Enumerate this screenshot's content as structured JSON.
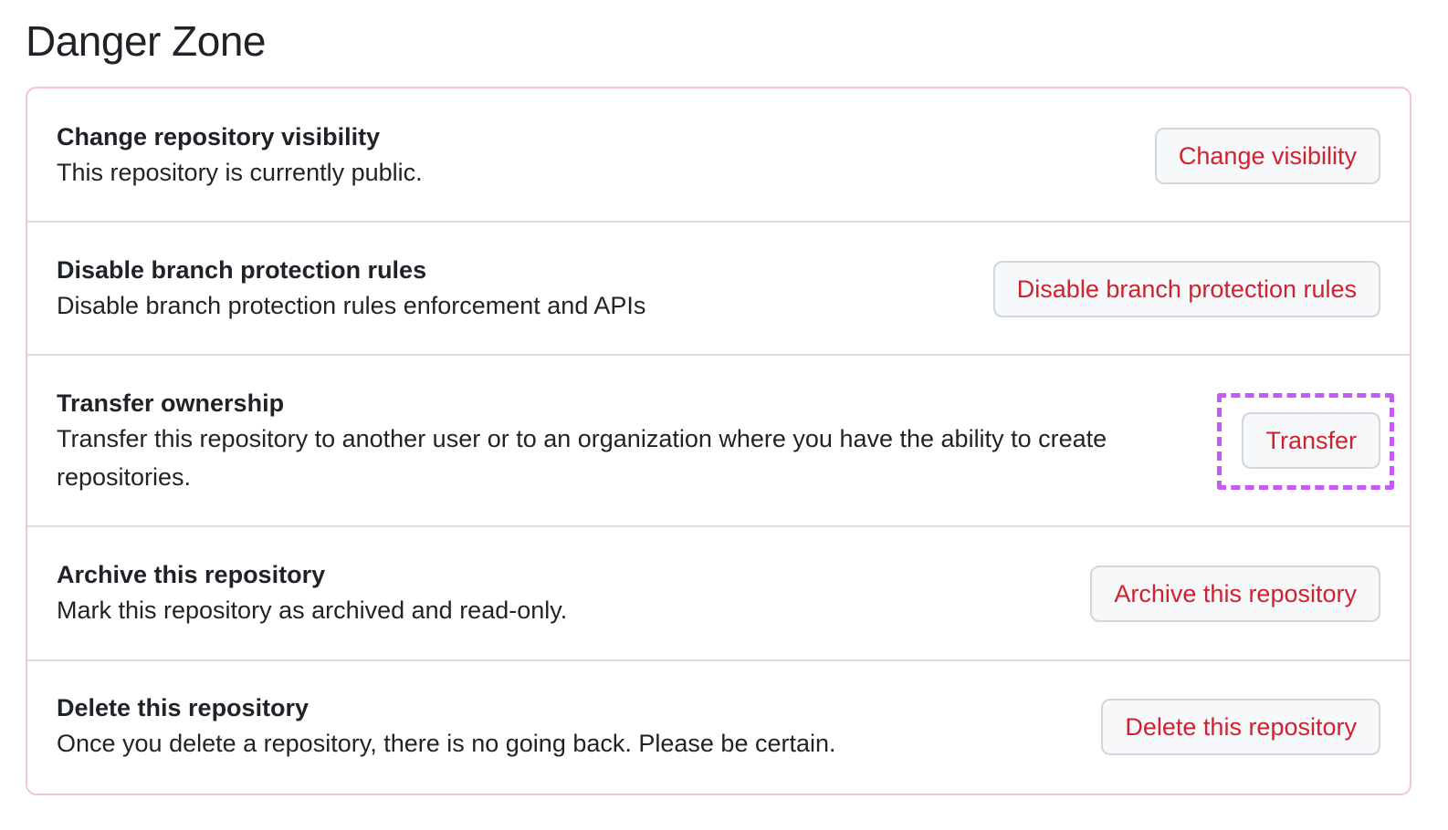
{
  "page": {
    "title": "Danger Zone"
  },
  "rows": [
    {
      "title": "Change repository visibility",
      "description": "This repository is currently public.",
      "button": "Change visibility"
    },
    {
      "title": "Disable branch protection rules",
      "description": "Disable branch protection rules enforcement and APIs",
      "button": "Disable branch protection rules"
    },
    {
      "title": "Transfer ownership",
      "description": "Transfer this repository to another user or to an organization where you have the ability to create repositories.",
      "button": "Transfer"
    },
    {
      "title": "Archive this repository",
      "description": "Mark this repository as archived and read-only.",
      "button": "Archive this repository"
    },
    {
      "title": "Delete this repository",
      "description": "Once you delete a repository, there is no going back. Please be certain.",
      "button": "Delete this repository"
    }
  ],
  "colors": {
    "danger_text": "#cf222e",
    "danger_border": "#f5c6c9",
    "highlight": "#c45bf5"
  }
}
